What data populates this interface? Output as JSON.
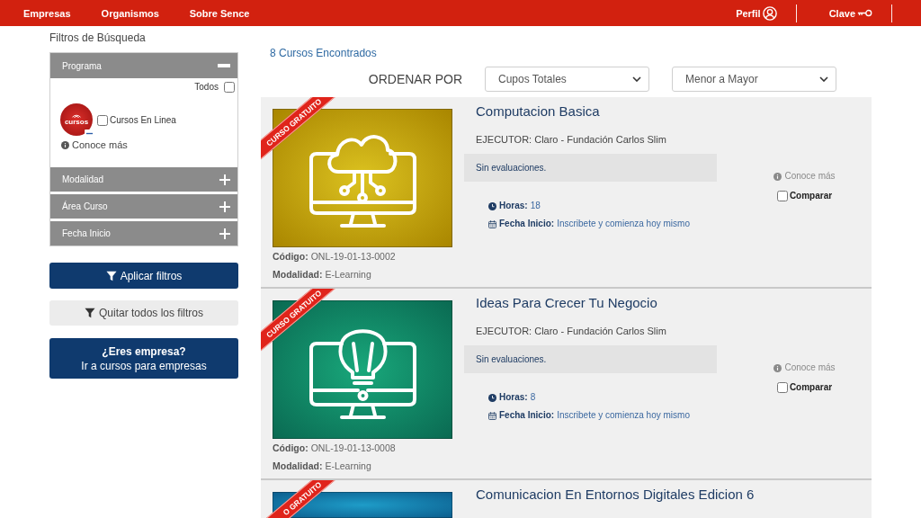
{
  "nav": {
    "links": [
      "Empresas",
      "Organismos",
      "Sobre Sence"
    ],
    "account": [
      {
        "kind": "user",
        "label": "Perfil"
      },
      {
        "kind": "key",
        "label": "Clave"
      }
    ]
  },
  "sidebar": {
    "title": "Filtros de Búsqueda",
    "filters": [
      {
        "label": "Programa",
        "expanded": true,
        "select_all": {
          "label": "Todos",
          "checked": false
        },
        "options": [
          {
            "logo_text": "cursos",
            "label": "Cursos En Linea",
            "checked": false
          }
        ],
        "more": "Conoce más"
      },
      {
        "label": "Modalidad",
        "expanded": false
      },
      {
        "label": "Área Curso",
        "expanded": false
      },
      {
        "label": "Fecha Inicio",
        "expanded": false
      }
    ],
    "apply_button": "Aplicar filtros",
    "clear_button": "Quitar todos los filtros",
    "company_button": {
      "title": "¿Eres empresa?",
      "subtitle": "Ir a cursos para empresas"
    }
  },
  "results": {
    "count": "8 Cursos Encontrados",
    "sort_label": "ORDENAR POR",
    "sort_field": "Cupos Totales",
    "sort_order": "Menor a Mayor",
    "courses": [
      {
        "ribbon": "CURSO GRATUITO",
        "image": {
          "kind": "cloud"
        },
        "title": "Computacion Basica",
        "executor": "EJECUTOR: Claro - Fundación Carlos Slim",
        "rating": "Sin evaluaciones.",
        "hours": {
          "label": "Horas:",
          "value": "18"
        },
        "start": {
          "label": "Fecha Inicio:",
          "value": "Inscribete y comienza hoy mismo"
        },
        "code": {
          "label": "Código:",
          "value": "ONL-19-01-13-0002"
        },
        "modality": {
          "label": "Modalidad:",
          "value": "E-Learning"
        },
        "more": "Conoce más",
        "compare": {
          "label": "Comparar",
          "checked": false
        }
      },
      {
        "ribbon": "CURSO GRATUITO",
        "image": {
          "kind": "bulb"
        },
        "title": "Ideas Para Crecer Tu Negocio",
        "executor": "EJECUTOR: Claro - Fundación Carlos Slim",
        "rating": "Sin evaluaciones.",
        "hours": {
          "label": "Horas:",
          "value": "8"
        },
        "start": {
          "label": "Fecha Inicio:",
          "value": "Inscribete y comienza hoy mismo"
        },
        "code": {
          "label": "Código:",
          "value": "ONL-19-01-13-0008"
        },
        "modality": {
          "label": "Modalidad:",
          "value": "E-Learning"
        },
        "more": "Conoce más",
        "compare": {
          "label": "Comparar",
          "checked": false
        }
      },
      {
        "ribbon": "O GRATUITO",
        "image": {
          "kind": "screen"
        },
        "title": "Comunicacion En Entornos Digitales Edicion 6"
      }
    ]
  }
}
